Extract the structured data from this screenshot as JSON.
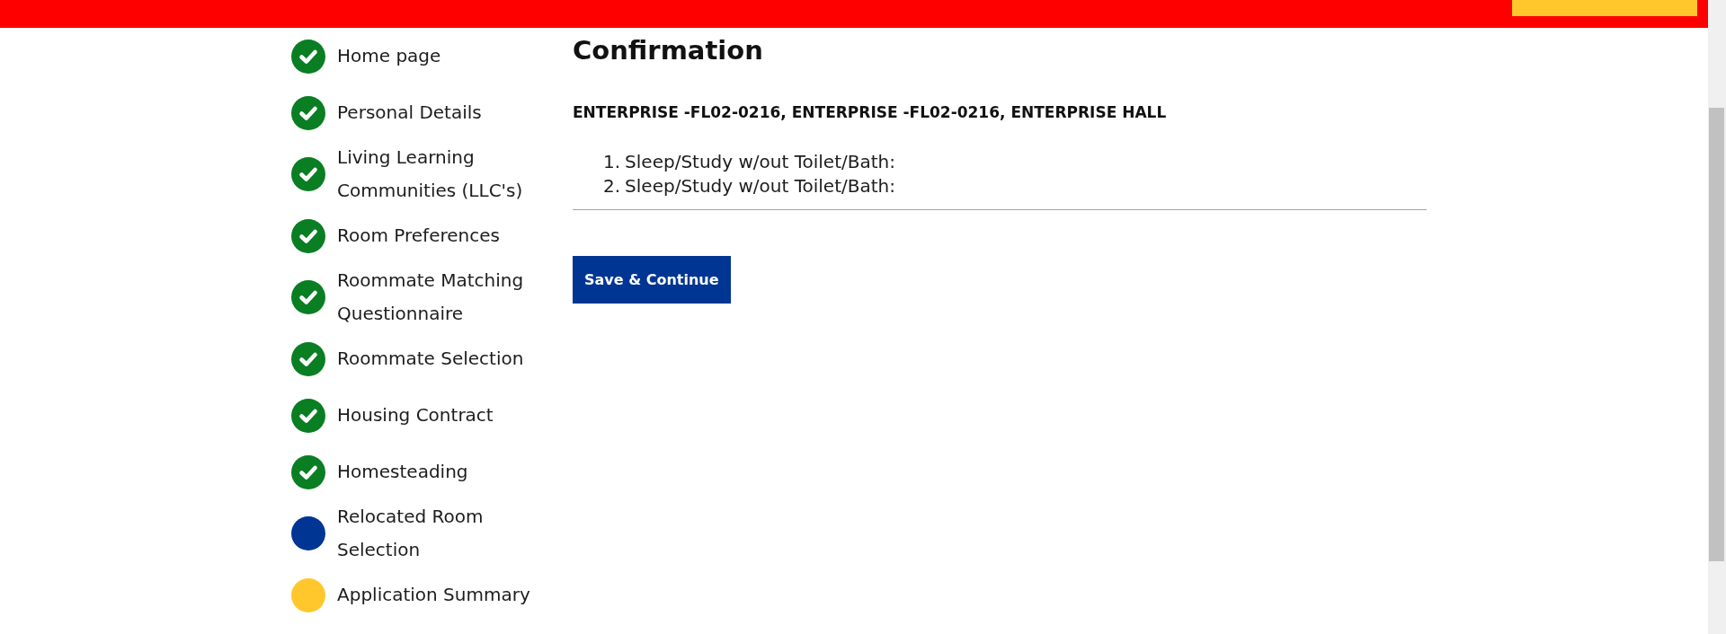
{
  "sidebar": {
    "steps": [
      {
        "label": "Home page",
        "completed": true,
        "color": "#0a7e22"
      },
      {
        "label": "Personal Details",
        "completed": true,
        "color": "#0a7e22"
      },
      {
        "label": "Living Learning Communities (LLC's)",
        "completed": true,
        "color": "#0a7e22"
      },
      {
        "label": "Room Preferences",
        "completed": true,
        "color": "#0a7e22"
      },
      {
        "label": "Roommate Matching Questionnaire",
        "completed": true,
        "color": "#0a7e22"
      },
      {
        "label": "Roommate Selection",
        "completed": true,
        "color": "#0a7e22"
      },
      {
        "label": "Housing Contract",
        "completed": true,
        "color": "#0a7e22"
      },
      {
        "label": "Homesteading",
        "completed": true,
        "color": "#0a7e22"
      },
      {
        "label": "Relocated Room Selection",
        "completed": false,
        "color": "#003594"
      },
      {
        "label": "Application Summary",
        "completed": false,
        "color": "#ffc72c"
      }
    ]
  },
  "content": {
    "title": "Confirmation",
    "room": "ENTERPRISE -FL02-0216, ENTERPRISE -FL02-0216, ENTERPRISE HALL",
    "items": [
      {
        "number": "1.",
        "text": "Sleep/Study w/out Toilet/Bath:"
      },
      {
        "number": "2.",
        "text": "Sleep/Study w/out Toilet/Bath:"
      }
    ],
    "button": {
      "label": "Save & Continue"
    }
  }
}
